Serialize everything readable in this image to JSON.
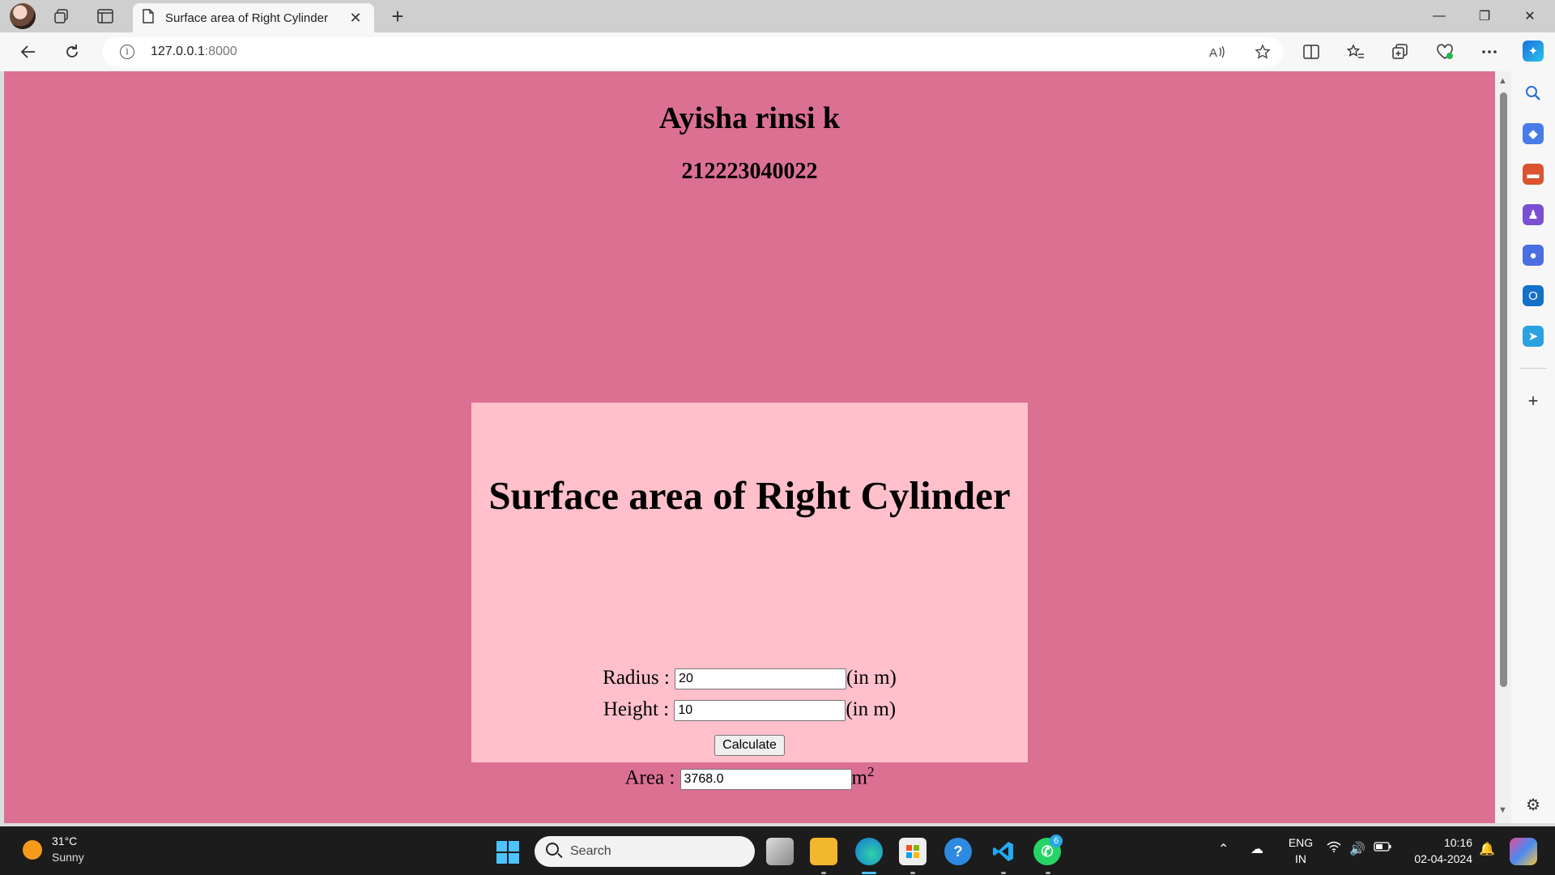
{
  "browser": {
    "tab_title": "Surface area of Right Cylinder",
    "tab_close": "✕",
    "new_tab": "+",
    "url_host": "127.0.0.1",
    "url_port": ":8000",
    "window_controls": {
      "minimize": "—",
      "restore": "❐",
      "close": "✕"
    }
  },
  "page": {
    "student_name": "Ayisha rinsi k",
    "student_id": "212223040022",
    "card_title": "Surface area of Right Cylinder",
    "radius_label": "Radius :",
    "radius_value": "20",
    "radius_unit": "(in m)",
    "height_label": "Height :",
    "height_value": "10",
    "height_unit": "(in m)",
    "calculate_label": "Calculate",
    "area_label": "Area :",
    "area_value": "3768.0",
    "area_unit": "m",
    "area_unit_exp": "2",
    "colors": {
      "background": "#db7093",
      "card": "#ffc0cb"
    }
  },
  "taskbar": {
    "temperature": "31°C",
    "weather": "Sunny",
    "search_placeholder": "Search",
    "whatsapp_badge": "6",
    "lang_line1": "ENG",
    "lang_line2": "IN",
    "time": "10:16",
    "date": "02-04-2024"
  }
}
